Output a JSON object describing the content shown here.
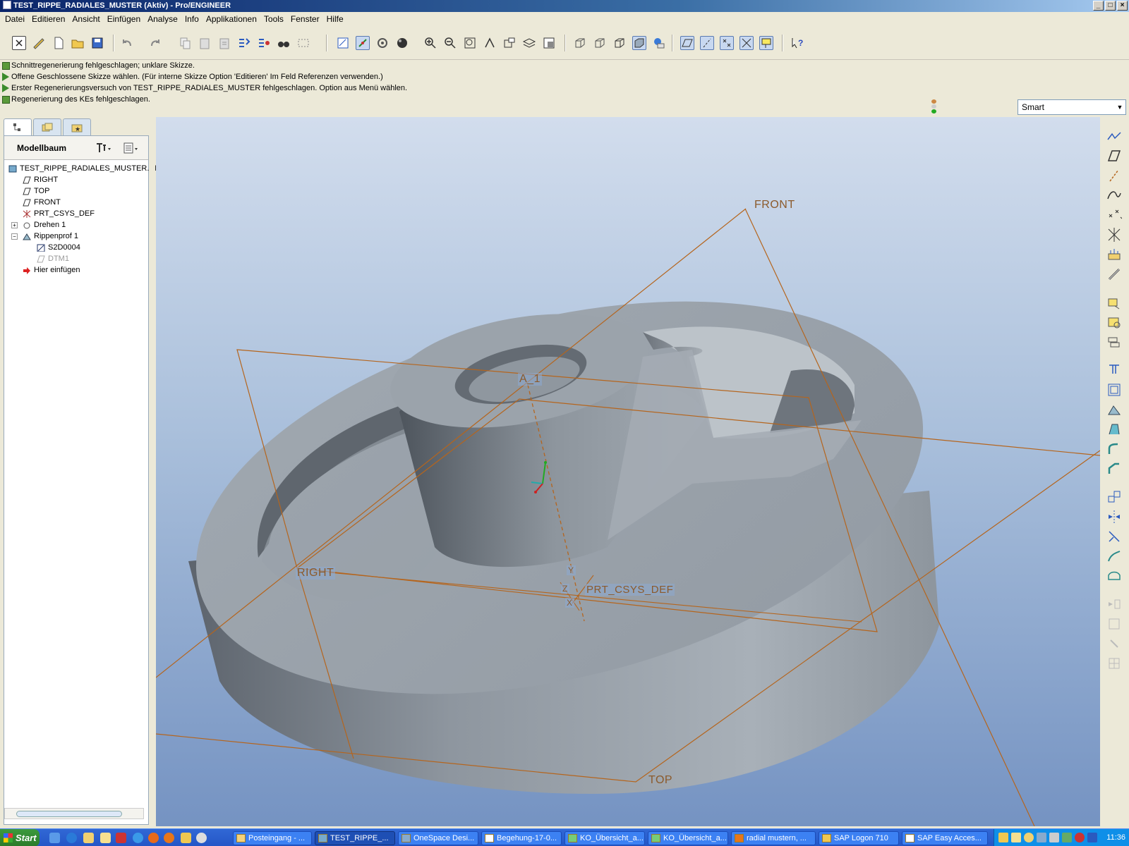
{
  "window": {
    "title": "TEST_RIPPE_RADIALES_MUSTER (Aktiv) - Pro/ENGINEER",
    "controls": [
      "_",
      "□",
      "×"
    ]
  },
  "menu": [
    "Datei",
    "Editieren",
    "Ansicht",
    "Einfügen",
    "Analyse",
    "Info",
    "Applikationen",
    "Tools",
    "Fenster",
    "Hilfe"
  ],
  "messages": [
    {
      "icon": "warn",
      "text": "Schnittregenerierung fehlgeschlagen; unklare Skizze."
    },
    {
      "icon": "arrow",
      "text": "Offene Geschlossene Skizze wählen. (Für interne Skizze Option 'Editieren' Im Feld Referenzen verwenden.)"
    },
    {
      "icon": "arrow",
      "text": "Erster Regenerierungsversuch von TEST_RIPPE_RADIALES_MUSTER fehlgeschlagen. Option aus Menü wählen."
    },
    {
      "icon": "warn",
      "text": "Regenerierung des KEs fehlgeschlagen."
    }
  ],
  "filter": {
    "value": "Smart"
  },
  "model_tree": {
    "title": "Modellbaum",
    "nodes": [
      {
        "label": "TEST_RIPPE_RADIALES_MUSTER.PI",
        "icon": "part-icon",
        "dim": false
      },
      {
        "label": "RIGHT",
        "icon": "datum-plane-icon",
        "dim": false
      },
      {
        "label": "TOP",
        "icon": "datum-plane-icon",
        "dim": false
      },
      {
        "label": "FRONT",
        "icon": "datum-plane-icon",
        "dim": false
      },
      {
        "label": "PRT_CSYS_DEF",
        "icon": "csys-icon",
        "dim": false
      },
      {
        "label": "Drehen 1",
        "icon": "revolve-icon",
        "dim": false
      },
      {
        "label": "Rippenprof 1",
        "icon": "rib-icon",
        "dim": false
      },
      {
        "label": "S2D0004",
        "icon": "sketch-icon",
        "dim": false
      },
      {
        "label": "DTM1",
        "icon": "datum-plane-icon",
        "dim": true
      },
      {
        "label": "Hier einfügen",
        "icon": "insert-arrow-icon",
        "dim": false
      }
    ]
  },
  "viewport": {
    "labels": {
      "front": "FRONT",
      "right": "RIGHT",
      "top": "TOP",
      "axis": "A_1",
      "csys": "PRT_CSYS_DEF",
      "y": "Y",
      "z": "Z",
      "x": "X"
    },
    "colors": {
      "datum": "#b5651d",
      "part": "#9aa3ad",
      "bg_top": "#d2dded",
      "bg_bottom": "#7593c2"
    }
  },
  "taskbar": {
    "start": "Start",
    "tasks": [
      {
        "label": "Posteingang - ...",
        "active": false
      },
      {
        "label": "TEST_RIPPE_...",
        "active": true
      },
      {
        "label": "OneSpace Desi...",
        "active": false
      },
      {
        "label": "Begehung-17-0...",
        "active": false
      },
      {
        "label": "KO_Übersicht_a...",
        "active": false
      },
      {
        "label": "KO_Übersicht_a...",
        "active": false
      },
      {
        "label": "radial mustern, ...",
        "active": false
      },
      {
        "label": "SAP Logon 710",
        "active": false
      },
      {
        "label": "SAP Easy Acces...",
        "active": false
      }
    ],
    "clock": "11:36"
  }
}
